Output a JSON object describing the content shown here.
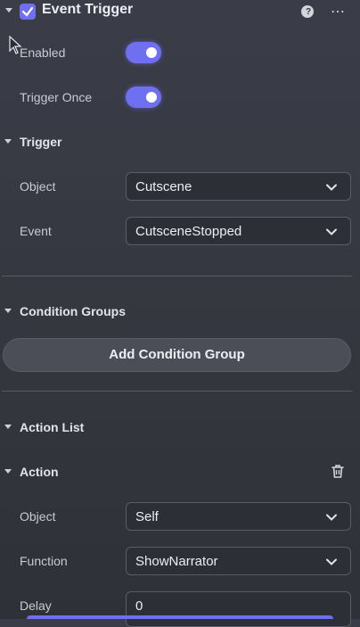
{
  "header": {
    "title": "Event Trigger",
    "enabled_checked": true
  },
  "enabled": {
    "label": "Enabled",
    "on": true
  },
  "trigger_once": {
    "label": "Trigger Once",
    "on": true
  },
  "trigger": {
    "title": "Trigger",
    "object_label": "Object",
    "object_value": "Cutscene",
    "event_label": "Event",
    "event_value": "CutsceneStopped"
  },
  "condition_groups": {
    "title": "Condition Groups",
    "add_label": "Add Condition Group"
  },
  "action_list": {
    "title": "Action List"
  },
  "action": {
    "title": "Action",
    "object_label": "Object",
    "object_value": "Self",
    "function_label": "Function",
    "function_value": "ShowNarrator",
    "delay_label": "Delay",
    "delay_value": "0"
  },
  "colors": {
    "accent": "#6f6ff2",
    "panel": "#363842",
    "field": "#2d2f37"
  }
}
